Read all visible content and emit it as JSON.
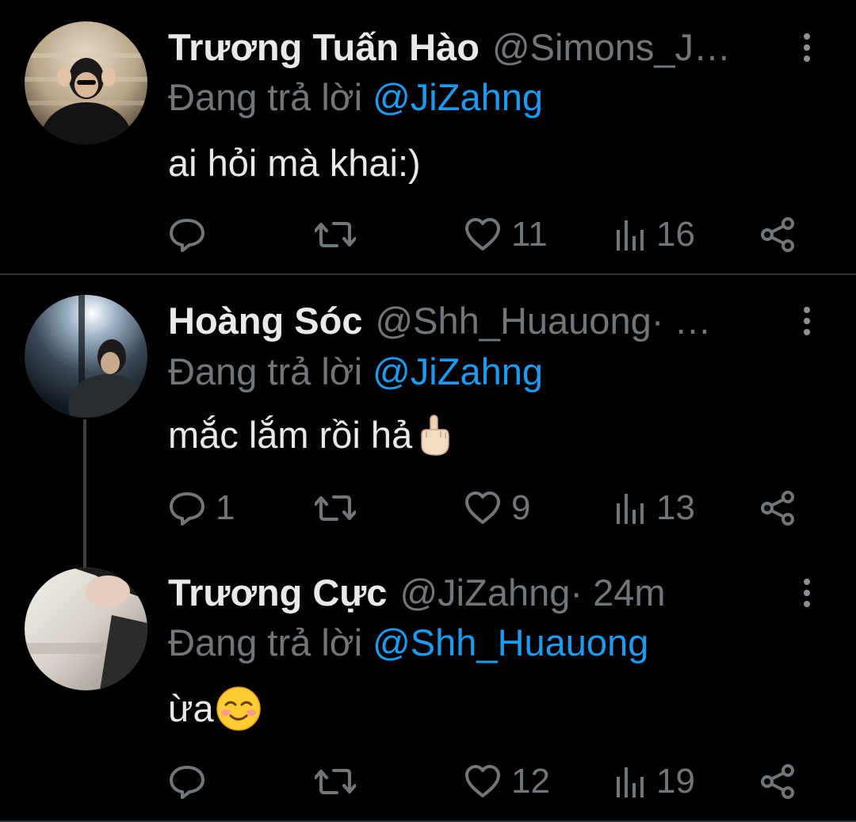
{
  "tweets": [
    {
      "name": "Trương Tuấn Hào",
      "handle": "@Simons_J…",
      "meta": "",
      "replying_prefix": "Đang trả lời ",
      "replying_to": "@JiZahng",
      "text": "ai hỏi mà khai:)",
      "emoji": "",
      "reply_count": "",
      "like_count": "11",
      "view_count": "16"
    },
    {
      "name": "Hoàng Sóc",
      "handle": "@Shh_Huauong",
      "meta": " · …",
      "replying_prefix": "Đang trả lời ",
      "replying_to": "@JiZahng",
      "text": "mắc lắm rồi hả",
      "emoji": "middle-finger-emoji",
      "reply_count": "1",
      "like_count": "9",
      "view_count": "13"
    },
    {
      "name": "Trương Cực",
      "handle": "@JiZahng",
      "meta": " · 24m",
      "replying_prefix": "Đang trả lời ",
      "replying_to": "@Shh_Huauong",
      "text": "ừa",
      "emoji": "smiling-face-emoji",
      "reply_count": "",
      "like_count": "12",
      "view_count": "19"
    }
  ],
  "icons": [
    "more-icon",
    "reply-icon",
    "retweet-icon",
    "like-icon",
    "views-icon",
    "share-icon"
  ],
  "colors": {
    "background": "#000000",
    "text_primary": "#e7e9ea",
    "text_secondary": "#71767b",
    "mention": "#1d9bf0",
    "divider": "#2f3336"
  }
}
